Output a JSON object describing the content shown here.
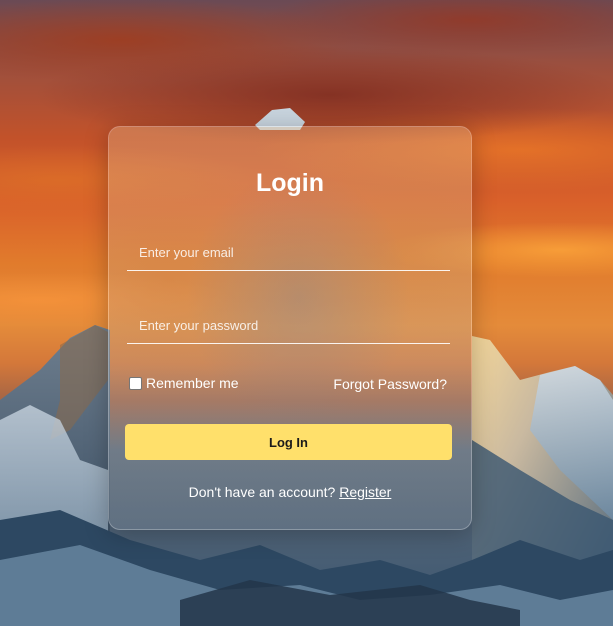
{
  "login_form": {
    "title": "Login",
    "email_placeholder": "Enter your email",
    "password_placeholder": "Enter your password",
    "remember_label": "Remember me",
    "remember_checked": false,
    "forgot_label": "Forgot Password?",
    "submit_label": "Log In",
    "register_prompt": "Don't have an account?",
    "register_label": "Register"
  },
  "colors": {
    "button_bg": "#ffe06b",
    "text": "#ffffff"
  },
  "background": {
    "icon": "mountain-sunset-landscape"
  }
}
